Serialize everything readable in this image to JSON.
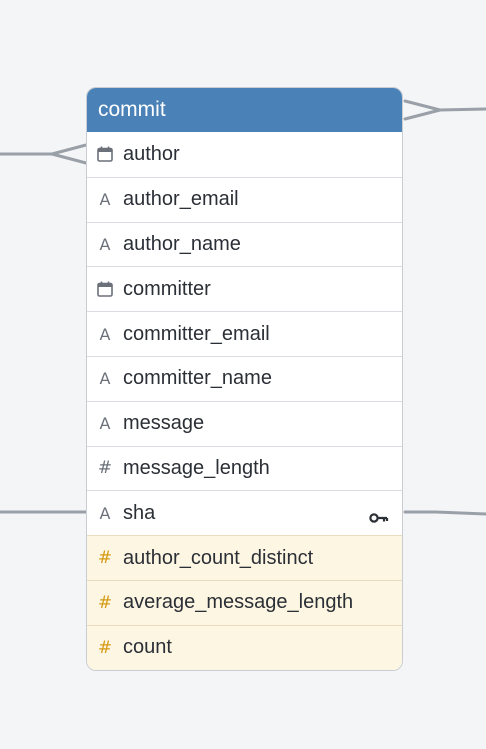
{
  "table": {
    "name": "commit",
    "columns": [
      {
        "name": "author",
        "type": "date-icon",
        "kind": "dimension"
      },
      {
        "name": "author_email",
        "type": "text-icon",
        "kind": "dimension"
      },
      {
        "name": "author_name",
        "type": "text-icon",
        "kind": "dimension"
      },
      {
        "name": "committer",
        "type": "date-icon",
        "kind": "dimension"
      },
      {
        "name": "committer_email",
        "type": "text-icon",
        "kind": "dimension"
      },
      {
        "name": "committer_name",
        "type": "text-icon",
        "kind": "dimension"
      },
      {
        "name": "message",
        "type": "text-icon",
        "kind": "dimension"
      },
      {
        "name": "message_length",
        "type": "number-icon",
        "kind": "dimension"
      },
      {
        "name": "sha",
        "type": "text-icon",
        "kind": "dimension",
        "primary_key": true
      },
      {
        "name": "author_count_distinct",
        "type": "number-icon",
        "kind": "measure"
      },
      {
        "name": "average_message_length",
        "type": "number-icon",
        "kind": "measure"
      },
      {
        "name": "count",
        "type": "number-icon",
        "kind": "measure"
      }
    ]
  },
  "colors": {
    "header": "#4a82b7",
    "measure_background": "#fdf6e3",
    "measure_icon": "#d59b14",
    "connector": "#9aa0a8"
  }
}
